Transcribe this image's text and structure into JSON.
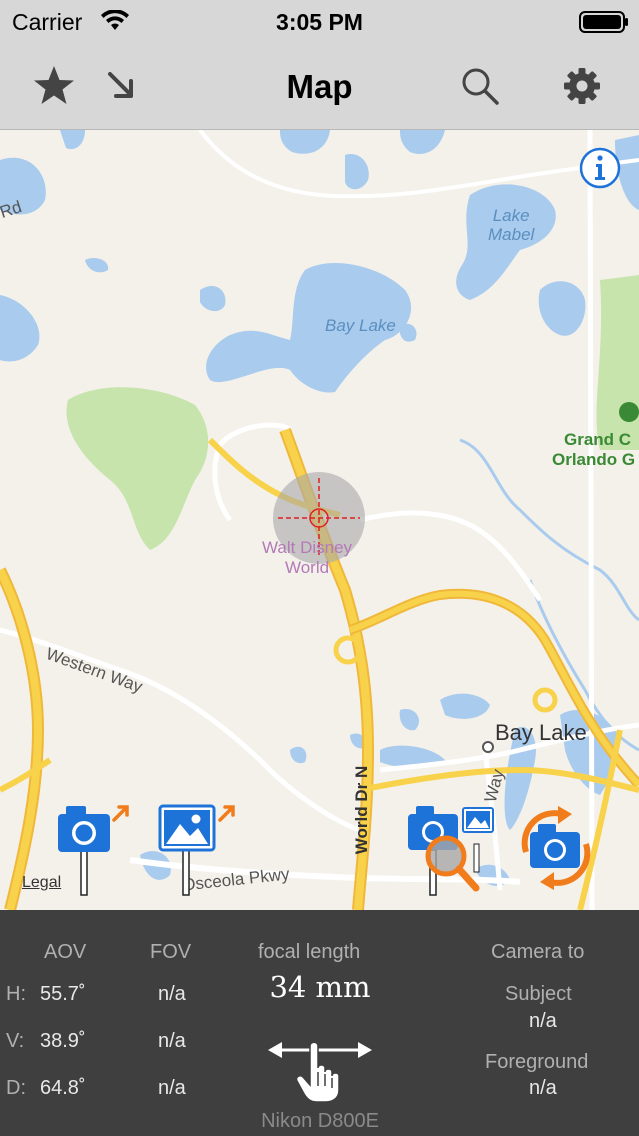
{
  "status": {
    "carrier": "Carrier",
    "time": "3:05 PM"
  },
  "navbar": {
    "title": "Map",
    "icons": [
      "star-icon",
      "arrow-down-right-icon",
      "search-icon",
      "gear-icon"
    ]
  },
  "map": {
    "water_labels": {
      "lake_mabel_1": "Lake",
      "lake_mabel_2": "Mabel",
      "bay_lake": "Bay Lake"
    },
    "road_labels": {
      "partial_rd": "Rd",
      "western_way": "Western Way",
      "world_dr": "World Dr N",
      "osceola": "Osceola Pkwy",
      "way": "Way"
    },
    "park_labels": {
      "grand_1": "Grand C",
      "grand_2": "Orlando G"
    },
    "poi_labels": {
      "wdw_1": "Walt Disney",
      "wdw_2": "World"
    },
    "place_labels": {
      "bay_lake_place": "Bay Lake"
    },
    "legal": "Legal",
    "colors": {
      "water": "#a9cbee",
      "park": "#c6e4ac",
      "highway": "#f8d24a",
      "road": "#ffffff",
      "land": "#f4f1ea",
      "accent": "#1e73d8",
      "orange": "#f07c1b"
    }
  },
  "panel": {
    "aov_header": "AOV",
    "fov_header": "FOV",
    "focal_header": "focal length",
    "focal_value": "34 mm",
    "camera_to": "Camera to",
    "subject_label": "Subject",
    "subject_value": "n/a",
    "foreground_label": "Foreground",
    "foreground_value": "n/a",
    "rows": [
      {
        "axis": "H:",
        "aov": "55.7˚",
        "fov": "n/a"
      },
      {
        "axis": "V:",
        "aov": "38.9˚",
        "fov": "n/a"
      },
      {
        "axis": "D:",
        "aov": "64.8˚",
        "fov": "n/a"
      }
    ],
    "device": "Nikon D800E"
  }
}
